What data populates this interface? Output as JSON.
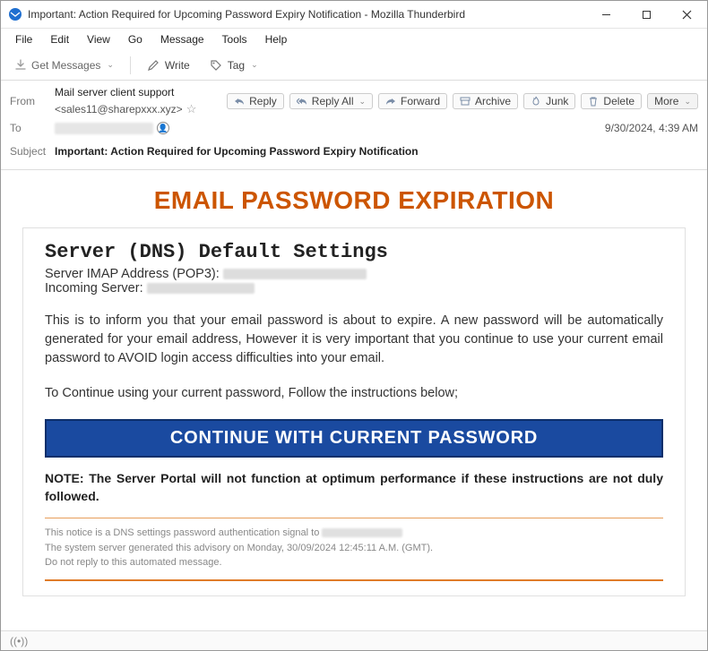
{
  "window": {
    "title": "Important: Action Required for Upcoming Password Expiry Notification - Mozilla Thunderbird"
  },
  "menu": {
    "file": "File",
    "edit": "Edit",
    "view": "View",
    "go": "Go",
    "message": "Message",
    "tools": "Tools",
    "help": "Help"
  },
  "toolbar": {
    "get": "Get Messages",
    "write": "Write",
    "tag": "Tag"
  },
  "headers": {
    "from_label": "From",
    "from_name": "Mail server client support",
    "from_email": "<sales11@sharepxxx.xyz>",
    "to_label": "To",
    "subject_label": "Subject",
    "subject": "Important: Action Required for Upcoming Password Expiry Notification",
    "date": "9/30/2024, 4:39 AM"
  },
  "actions": {
    "reply": "Reply",
    "reply_all": "Reply All",
    "forward": "Forward",
    "archive": "Archive",
    "junk": "Junk",
    "delete": "Delete",
    "more": "More"
  },
  "email": {
    "title": "EMAIL PASSWORD EXPIRATION",
    "h2": "Server (DNS) Default Settings",
    "imap_label": "Server IMAP Address (POP3): ",
    "incoming_label": "Incoming Server: ",
    "p1": "This is to inform you that your email password is about to expire. A new password will be automatically generated for your email address, However it is very important that you continue to use your current email password to AVOID login access difficulties into your email.",
    "p2": "To Continue using your current password, Follow the instructions below;",
    "cta": "CONTINUE WITH CURRENT PASSWORD",
    "note": "NOTE: The Server Portal will not function at optimum performance if these instructions are not duly followed.",
    "foot1": "This notice is a DNS settings password authentication signal to ",
    "foot2": "The system server generated this advisory on Monday, 30/09/2024 12:45:11 A.M. (GMT).",
    "foot3": "Do not reply to this automated message."
  }
}
